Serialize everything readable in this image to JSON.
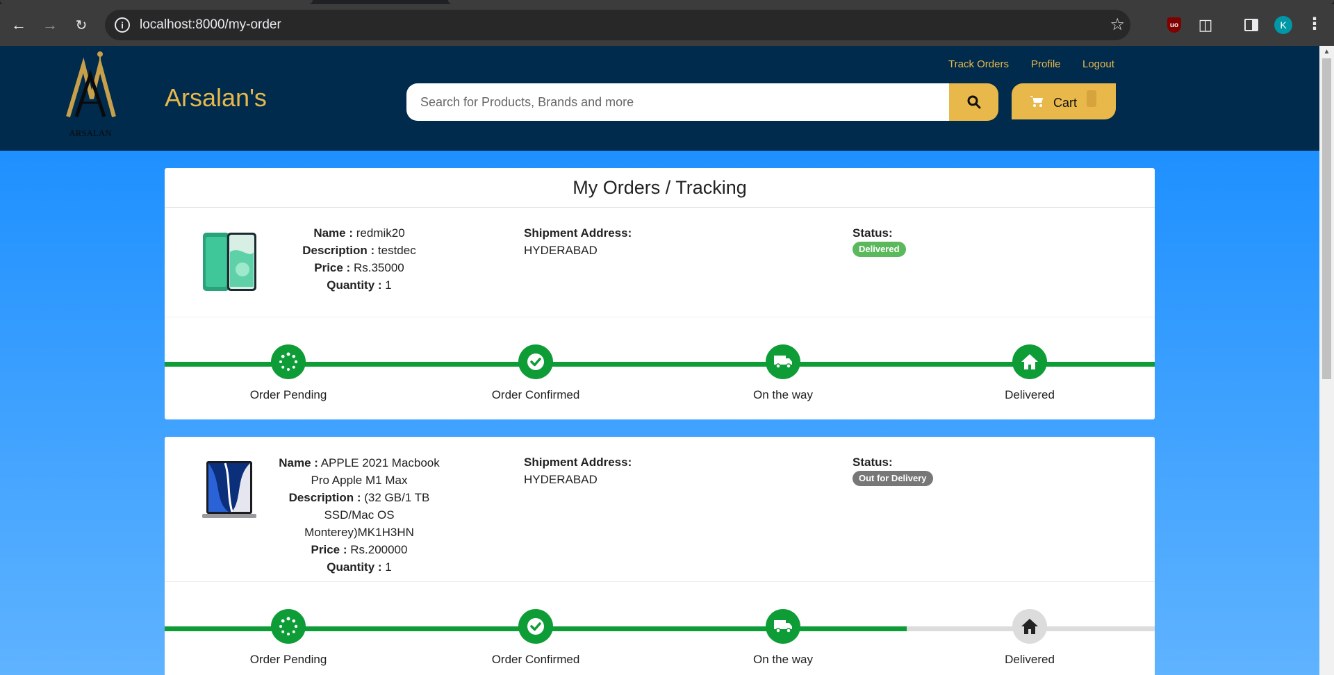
{
  "browser": {
    "url": "localhost:8000/my-order",
    "avatar_letter": "K",
    "ublock_label": "uo"
  },
  "header": {
    "brand": "Arsalan's",
    "logo_text": "ARSALAN",
    "links": {
      "track": "Track Orders",
      "profile": "Profile",
      "logout": "Logout"
    },
    "search_placeholder": "Search for Products, Brands and more",
    "cart_label": "Cart",
    "accent_color": "#e8b84b",
    "header_color": "#002b4d"
  },
  "page": {
    "title": "My Orders / Tracking"
  },
  "labels": {
    "name": "Name :",
    "description": "Description :",
    "price": "Price :",
    "quantity": "Quantity :",
    "shipment": "Shipment Address:",
    "status": "Status:"
  },
  "orders": [
    {
      "name": "redmik20",
      "description": "testdec",
      "price": "Rs.35000",
      "quantity": "1",
      "address": "HYDERABAD",
      "status": "Delivered",
      "image_icon": "phone-image",
      "steps": [
        {
          "label": "Order Pending",
          "icon": "spinner-icon",
          "done": true
        },
        {
          "label": "Order Confirmed",
          "icon": "check-icon",
          "done": true
        },
        {
          "label": "On the way",
          "icon": "truck-icon",
          "done": true
        },
        {
          "label": "Delivered",
          "icon": "home-icon",
          "done": true
        }
      ]
    },
    {
      "name": "APPLE 2021 Macbook Pro Apple M1 Max",
      "description": "(32 GB/1 TB SSD/Mac OS Monterey)MK1H3HN",
      "price": "Rs.200000",
      "quantity": "1",
      "address": "HYDERABAD",
      "status": "Out for Delivery",
      "image_icon": "laptop-image",
      "steps": [
        {
          "label": "Order Pending",
          "icon": "spinner-icon",
          "done": true
        },
        {
          "label": "Order Confirmed",
          "icon": "check-icon",
          "done": true
        },
        {
          "label": "On the way",
          "icon": "truck-icon",
          "done": true
        },
        {
          "label": "Delivered",
          "icon": "home-icon",
          "done": false
        }
      ]
    }
  ]
}
